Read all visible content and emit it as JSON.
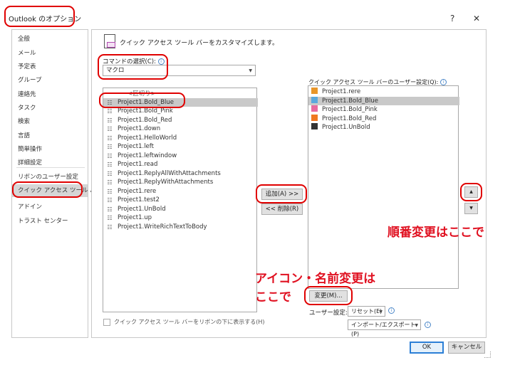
{
  "dialog": {
    "title": "Outlook のオプション",
    "help_glyph": "?",
    "close_glyph": "✕"
  },
  "sidebar": {
    "items": [
      {
        "label": "全般"
      },
      {
        "label": "メール"
      },
      {
        "label": "予定表"
      },
      {
        "label": "グループ"
      },
      {
        "label": "連絡先"
      },
      {
        "label": "タスク"
      },
      {
        "label": "検索"
      },
      {
        "label": "言語"
      },
      {
        "label": "簡単操作"
      },
      {
        "label": "詳細設定"
      },
      {
        "label": "リボンのユーザー設定"
      },
      {
        "label": "クイック アクセス ツール バー"
      },
      {
        "label": "アドイン"
      },
      {
        "label": "トラスト センター"
      }
    ]
  },
  "main": {
    "heading": "クイック アクセス ツール バーをカスタマイズします。",
    "choose_label": "コマンドの選択(C):",
    "choose_value": "マクロ",
    "left_list": [
      "<区切り>",
      "Project1.Bold_Blue",
      "Project1.Bold_Pink",
      "Project1.Bold_Red",
      "Project1.down",
      "Project1.HelloWorld",
      "Project1.left",
      "Project1.leftwindow",
      "Project1.read",
      "Project1.ReplyAllWithAttachments",
      "Project1.ReplyWithAttachments",
      "Project1.rere",
      "Project1.test2",
      "Project1.UnBold",
      "Project1.up",
      "Project1.WriteRichTextToBody"
    ],
    "right_label": "クイック アクセス ツール バーのユーザー設定(Q):",
    "right_list": [
      {
        "label": "Project1.rere",
        "color": "#e8962a"
      },
      {
        "label": "Project1.Bold_Blue",
        "color": "#5aa8dd"
      },
      {
        "label": "Project1.Bold_Pink",
        "color": "#e86aa0"
      },
      {
        "label": "Project1.Bold_Red",
        "color": "#f07820"
      },
      {
        "label": "Project1.UnBold",
        "color": "#333333"
      }
    ],
    "add_button": "追加(A) >>",
    "remove_button": "<< 削除(R)",
    "modify_button": "変更(M)...",
    "user_setting_label": "ユーザー設定:",
    "reset_button": "リセット(E)",
    "import_export_button": "インポート/エクスポート(P)",
    "show_below_ribbon": "クイック アクセス ツール バーをリボンの下に表示する(H)",
    "up_glyph": "▲",
    "down_glyph": "▼"
  },
  "annotations": {
    "order_note": "順番変更はここで",
    "icon_note_line1": "アイコン・名前変更は",
    "icon_note_line2": "ここで"
  },
  "footer": {
    "ok": "OK",
    "cancel": "キャンセル"
  }
}
